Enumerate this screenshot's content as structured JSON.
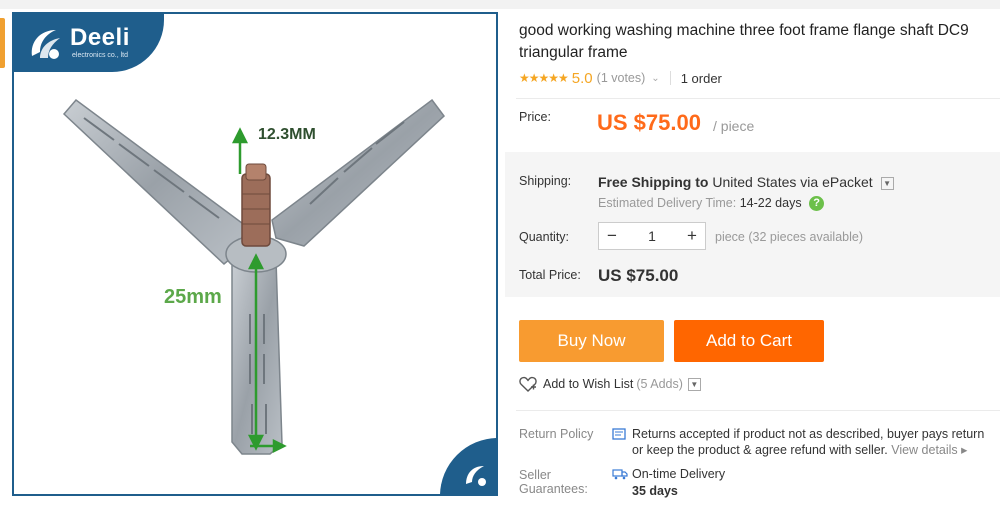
{
  "image": {
    "brand_name": "Deeli",
    "brand_sub": "electronics co., ltd",
    "dimension_top": "12.3MM",
    "dimension_left": "25mm"
  },
  "product": {
    "title_line1": "good working washing machine three foot frame flange shaft DC9",
    "title_line2": "triangular frame",
    "rating_stars": "★★★★★",
    "rating": "5.0",
    "votes": "(1 votes)",
    "orders": "1 order"
  },
  "price": {
    "label": "Price:",
    "value": "US $75.00",
    "unit": "/ piece"
  },
  "shipping": {
    "label": "Shipping:",
    "free": "Free Shipping to",
    "destination": "United States via ePacket",
    "delivery_label": "Estimated Delivery Time:",
    "delivery_days": "14-22 days",
    "help_glyph": "?"
  },
  "quantity": {
    "label": "Quantity:",
    "minus": "−",
    "value": "1",
    "plus": "+",
    "note": "piece (32 pieces available)"
  },
  "total": {
    "label": "Total Price:",
    "value": "US $75.00"
  },
  "buttons": {
    "buy_now": "Buy Now",
    "add_to_cart": "Add to Cart"
  },
  "wishlist": {
    "label": "Add to Wish List",
    "adds": "(5 Adds)"
  },
  "policy": {
    "label": "Return Policy",
    "line1": "Returns accepted if product not as described, buyer pays return",
    "line2": "or keep the product & agree refund with seller.",
    "link": "View details ▸"
  },
  "guarantees": {
    "label_line1": "Seller",
    "label_line2": "Guarantees:",
    "item": "On-time Delivery",
    "days": "35 days"
  },
  "colors": {
    "accent_orange": "#ff6a1a",
    "buy_now": "#f89b30",
    "add_to_cart": "#ff6600",
    "brand_blue": "#1f5e8c",
    "star": "#f5a623"
  }
}
